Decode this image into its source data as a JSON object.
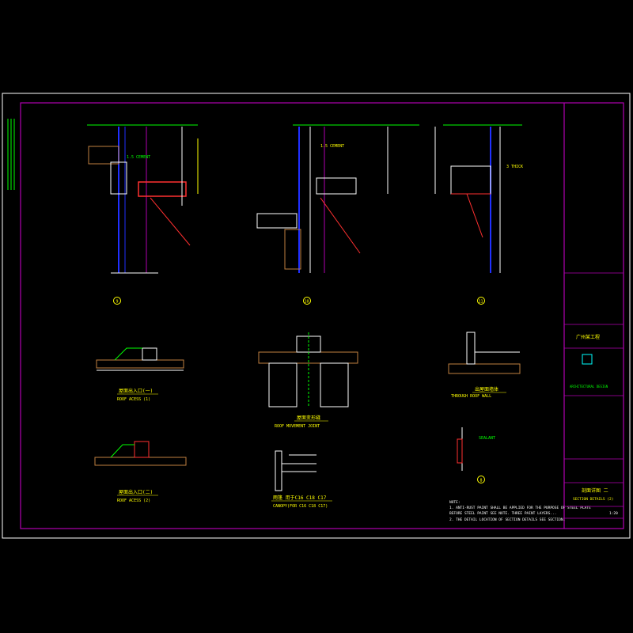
{
  "colors": {
    "background": "#000000",
    "border": "#ffffff",
    "frame": "#b000b0",
    "annotation": "#00ff00",
    "text": "#ffff00",
    "structure": "#ff3030",
    "steel": "#2030ff",
    "dimension": "#ffffff",
    "hatch": "#c08040",
    "cyan": "#00ffff"
  },
  "details": {
    "d9": {
      "number": "9"
    },
    "d10": {
      "number": "10"
    },
    "d11": {
      "number": "11"
    },
    "d8": {
      "number": "8"
    }
  },
  "sections": {
    "roof_access_1": {
      "cn": "屋面出入口(一)",
      "en": "ROOF ACESS (1)"
    },
    "roof_access_2": {
      "cn": "屋面出入口(二)",
      "en": "ROOF ACESS (2)"
    },
    "roof_movement_joint": {
      "cn": "屋面变形缝",
      "en": "ROOF MOVEMENT JOINT"
    },
    "through_roof_wall": {
      "cn": "出屋面墙体",
      "en": "THROUGH ROOF WALL"
    },
    "canopy": {
      "cn": "雨篷 用于C16 C18 C17",
      "en": "CANOPY(FOR C16 C18 C17)"
    }
  },
  "notes": {
    "en": [
      "NOTE:",
      "1. ANTI-RUST PAINT SHALL BE APPLIED FOR THE PURPOSE OF STEEL PLATE",
      "   BEFORE STEEL PAINT SEE NOTE. THREE PAINT LAYERS...",
      "2. THE DETAIL LOCATION OF SECTION DETAILS SEE SECTION."
    ]
  },
  "title_block": {
    "project": "广州某工程",
    "drawing_title": "剖面详图 二",
    "drawing_title_en": "SECTION DETAILS (2)",
    "scale": "1:20",
    "company_en": "ARCHITECTURAL DESIGN"
  }
}
